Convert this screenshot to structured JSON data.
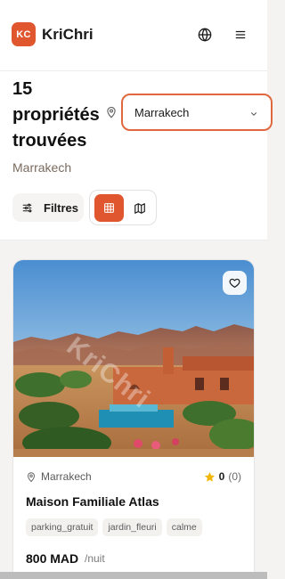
{
  "header": {
    "logo_badge": "KC",
    "brand_name": "KriChri",
    "language_icon": "globe-icon",
    "menu_icon": "hamburger-menu-icon"
  },
  "results": {
    "count_title": "15 propriétés trouvées",
    "selected_city": "Marrakech",
    "subtitle": "Marrakech",
    "filters_label": "Filtres",
    "view_mode": "grid"
  },
  "listing": {
    "watermark": "KriChri",
    "location": "Marrakech",
    "rating_value": "0",
    "rating_count": "(0)",
    "title": "Maison Familiale Atlas",
    "tags": [
      "parking_gratuit",
      "jardin_fleuri",
      "calme"
    ],
    "price": "800 MAD",
    "price_unit": "/nuit"
  },
  "colors": {
    "accent": "#e0562f",
    "accent_border": "#e0683f",
    "star": "#f2b705"
  }
}
